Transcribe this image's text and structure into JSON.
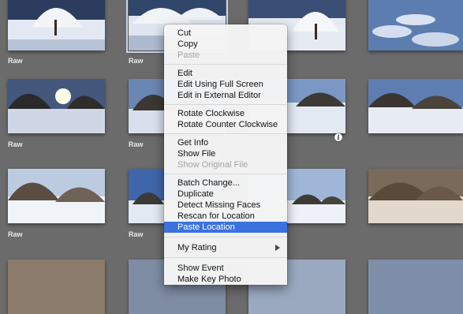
{
  "thumbnails": [
    {
      "row": 0,
      "col": 0,
      "label": "Raw"
    },
    {
      "row": 0,
      "col": 1,
      "label": "Raw",
      "selected": true
    },
    {
      "row": 0,
      "col": 2,
      "label": ""
    },
    {
      "row": 0,
      "col": 3,
      "label": ""
    },
    {
      "row": 1,
      "col": 0,
      "label": "Raw"
    },
    {
      "row": 1,
      "col": 1,
      "label": "Raw"
    },
    {
      "row": 1,
      "col": 2,
      "label": ""
    },
    {
      "row": 1,
      "col": 3,
      "label": ""
    },
    {
      "row": 2,
      "col": 0,
      "label": "Raw"
    },
    {
      "row": 2,
      "col": 1,
      "label": "Raw"
    },
    {
      "row": 2,
      "col": 2,
      "label": ""
    },
    {
      "row": 2,
      "col": 3,
      "label": ""
    }
  ],
  "colors": {
    "background": "#6b6b6b",
    "menu_highlight": "#3a72e0",
    "disabled_text": "#a3a3a3"
  },
  "context_menu": {
    "groups": [
      [
        {
          "label": "Cut",
          "enabled": true
        },
        {
          "label": "Copy",
          "enabled": true
        },
        {
          "label": "Paste",
          "enabled": false
        }
      ],
      [
        {
          "label": "Edit",
          "enabled": true
        },
        {
          "label": "Edit Using Full Screen",
          "enabled": true
        },
        {
          "label": "Edit in External Editor",
          "enabled": true
        }
      ],
      [
        {
          "label": "Rotate Clockwise",
          "enabled": true
        },
        {
          "label": "Rotate Counter Clockwise",
          "enabled": true
        }
      ],
      [
        {
          "label": "Get Info",
          "enabled": true
        },
        {
          "label": "Show File",
          "enabled": true
        },
        {
          "label": "Show Original File",
          "enabled": false
        }
      ],
      [
        {
          "label": "Batch Change...",
          "enabled": true
        },
        {
          "label": "Duplicate",
          "enabled": true
        },
        {
          "label": "Detect Missing Faces",
          "enabled": true
        },
        {
          "label": "Rescan for Location",
          "enabled": true
        },
        {
          "label": "Paste Location",
          "enabled": true,
          "highlighted": true
        }
      ],
      [
        {
          "label": "My Rating",
          "enabled": true,
          "submenu": true
        }
      ],
      [
        {
          "label": "Show Event",
          "enabled": true
        },
        {
          "label": "Make Key Photo",
          "enabled": true
        }
      ]
    ]
  }
}
